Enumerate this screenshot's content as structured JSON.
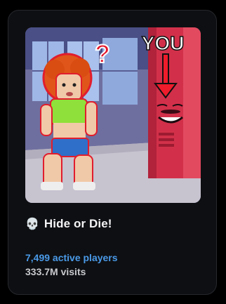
{
  "game_card": {
    "thumbnail_text": "YOU",
    "title": "Hide or Die!",
    "title_icon": "skull-icon",
    "title_icon_glyph": "💀",
    "active_players": "7,499 active players",
    "visits": "333.7M visits"
  },
  "colors": {
    "card_background": "#0e0f12",
    "active_players": "#4a9ae8",
    "visits": "#c8c9cd",
    "title": "#f4f4f6"
  }
}
